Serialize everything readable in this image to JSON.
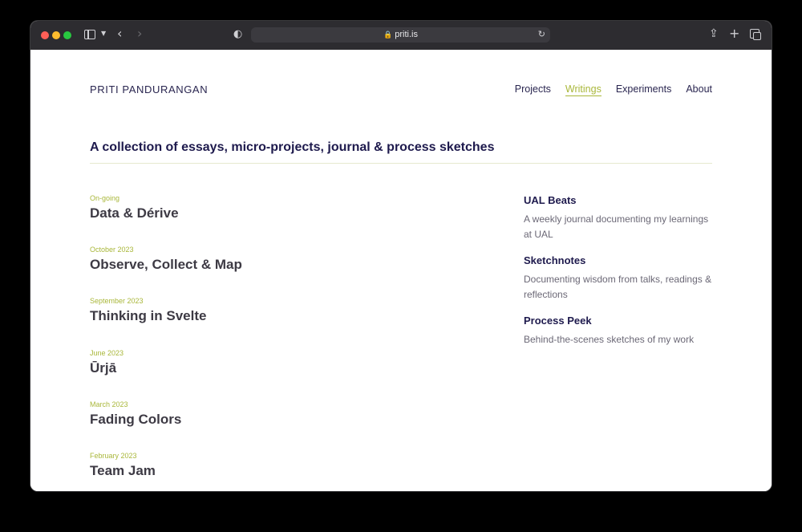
{
  "browser": {
    "url": "priti.is"
  },
  "site": {
    "title": "PRITI PANDURANGAN",
    "nav": [
      {
        "label": "Projects",
        "active": false
      },
      {
        "label": "Writings",
        "active": true
      },
      {
        "label": "Experiments",
        "active": false
      },
      {
        "label": "About",
        "active": false
      }
    ],
    "headline": "A collection of essays, micro-projects, journal & process sketches"
  },
  "writings": [
    {
      "date": "On-going",
      "title": "Data & Dérive"
    },
    {
      "date": "October 2023",
      "title": "Observe, Collect & Map"
    },
    {
      "date": "September 2023",
      "title": "Thinking in Svelte"
    },
    {
      "date": "June 2023",
      "title": "Ūrjā"
    },
    {
      "date": "March 2023",
      "title": "Fading Colors"
    },
    {
      "date": "February 2023",
      "title": "Team Jam"
    }
  ],
  "sidebar": [
    {
      "title": "UAL Beats",
      "description": "A weekly journal documenting my learnings at UAL"
    },
    {
      "title": "Sketchnotes",
      "description": "Documenting wisdom from talks, readings & reflections"
    },
    {
      "title": "Process Peek",
      "description": "Behind-the-scenes sketches of my work"
    }
  ],
  "colors": {
    "accent": "#a9b73a",
    "heading": "#1e1a4d"
  }
}
